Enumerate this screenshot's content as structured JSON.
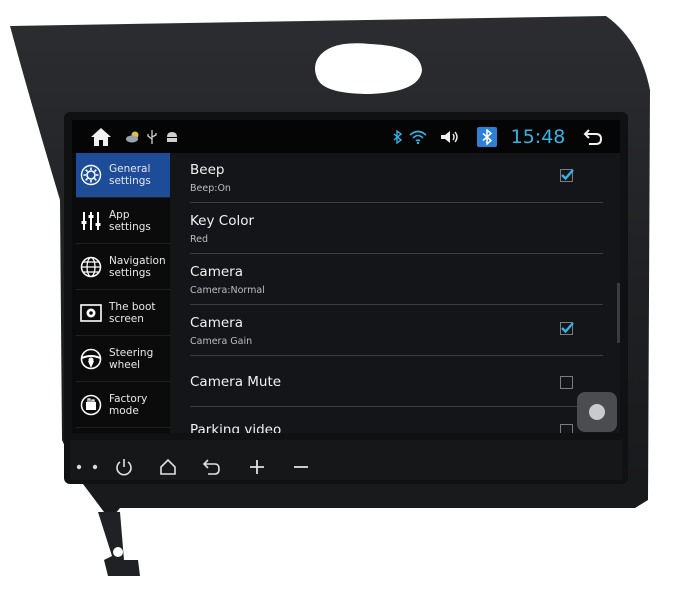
{
  "status_bar": {
    "time": "15:48",
    "icons": [
      "home-icon",
      "weather-icon",
      "usb-icon",
      "android-icon",
      "bluetooth-small-icon",
      "wifi-icon",
      "volume-icon",
      "bluetooth-button-icon",
      "back-icon"
    ]
  },
  "sidebar": {
    "items": [
      {
        "label": "General settings",
        "icon": "gear-icon",
        "active": true
      },
      {
        "label": "App settings",
        "icon": "sliders-icon"
      },
      {
        "label": "Navigation settings",
        "icon": "globe-icon"
      },
      {
        "label": "The boot screen",
        "icon": "image-icon"
      },
      {
        "label": "Steering wheel",
        "icon": "steering-wheel-icon"
      },
      {
        "label": "Factory mode",
        "icon": "factory-icon"
      }
    ]
  },
  "settings": {
    "rows": [
      {
        "title": "Beep",
        "subtitle": "Beep:On",
        "checked": true
      },
      {
        "title": "Key Color",
        "subtitle": "Red"
      },
      {
        "title": "Camera",
        "subtitle": "Camera:Normal"
      },
      {
        "title": "Camera",
        "subtitle": "Camera Gain",
        "checked": true
      },
      {
        "title": "Camera Mute",
        "checked": false
      },
      {
        "title": "Parking video",
        "checked": false
      }
    ]
  },
  "hardware_buttons": [
    "dot-icon",
    "dot-icon",
    "power-icon",
    "home-icon",
    "back-icon",
    "plus-icon",
    "minus-icon"
  ],
  "colors": {
    "accent": "#32b4e6",
    "selected": "#1d4d99",
    "bluetooth": "#2e7fd6"
  }
}
